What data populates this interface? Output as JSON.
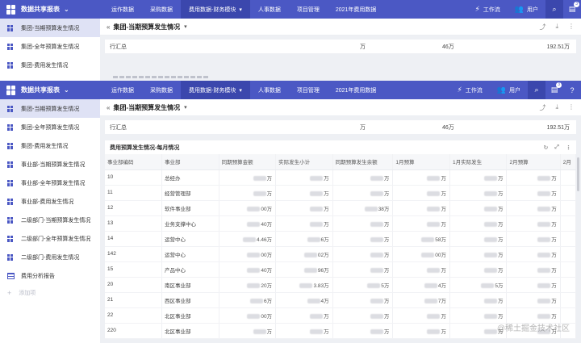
{
  "app_title": "数据共享报表",
  "nav_tabs": [
    "运作数据",
    "采购数据",
    "费用数据-财务模块",
    "人事数据",
    "项目管理",
    "2021年费用数据"
  ],
  "top_right": {
    "workflow": "工作流",
    "user": "用户",
    "notif_count": "3"
  },
  "sidebar_back": [
    "集团-当期预算发生情况",
    "集团-全年预算发生情况",
    "集团-费用发生情况"
  ],
  "sidebar": [
    "集团-当期预算发生情况",
    "集团-全年预算发生情况",
    "集团-费用发生情况",
    "事业部-当期预算发生情况",
    "事业部-全年预算发生情况",
    "事业部-费用发生情况",
    "二级部门-当期预算发生情况",
    "二级部门-全年预算发生情况",
    "二级部门-费用发生情况",
    "费用分析报告"
  ],
  "sidebar_add": "添加项",
  "page_title": "集团-当期预算发生情况",
  "summary_back": {
    "label": "行汇总",
    "v1": "万",
    "v2": "46万",
    "v3": "192.51万"
  },
  "ghost_title": "费用预算发生情况-每月情况",
  "summary": {
    "label": "行汇总",
    "v1": "万",
    "v2": "46万",
    "v3": "192.51万"
  },
  "table_title": "费用预算发生情况-每月情况",
  "columns": [
    "事业部编码",
    "事业部",
    "同期预算金额",
    "实际发生小计",
    "同期预算发生余额",
    "1月预算",
    "1月实际发生",
    "2月预算",
    "2月"
  ],
  "rows": [
    [
      "10",
      "总经办",
      "万",
      "万",
      "万",
      "万",
      "万",
      "万"
    ],
    [
      "11",
      "经营管理部",
      "万",
      "万",
      "万",
      "万",
      "万",
      "万"
    ],
    [
      "12",
      "软件事业部",
      "00万",
      "万",
      "38万",
      "万",
      "万",
      "万"
    ],
    [
      "13",
      "业务支撑中心",
      "40万",
      "万",
      "万",
      "万",
      "万",
      "万"
    ],
    [
      "14",
      "运营中心",
      "4.46万",
      "6万",
      "万",
      "58万",
      "万",
      "万"
    ],
    [
      "142",
      "运营中心",
      "00万",
      "02万",
      "万",
      "00万",
      "万",
      "万"
    ],
    [
      "15",
      "产品中心",
      "40万",
      "96万",
      "万",
      "万",
      "万",
      "万"
    ],
    [
      "20",
      "南区事业部",
      "20万",
      "3.83万",
      "5万",
      "4万",
      "5万",
      "万"
    ],
    [
      "21",
      "西区事业部",
      "6万",
      "4万",
      "万",
      "7万",
      "万",
      "万"
    ],
    [
      "22",
      "北区事业部",
      "00万",
      "万",
      "万",
      "万",
      "万",
      "万"
    ],
    [
      "220",
      "北区事业部",
      "万",
      "万",
      "万",
      "万",
      "万",
      "万"
    ]
  ],
  "watermark": "@稀土掘金技术社区"
}
